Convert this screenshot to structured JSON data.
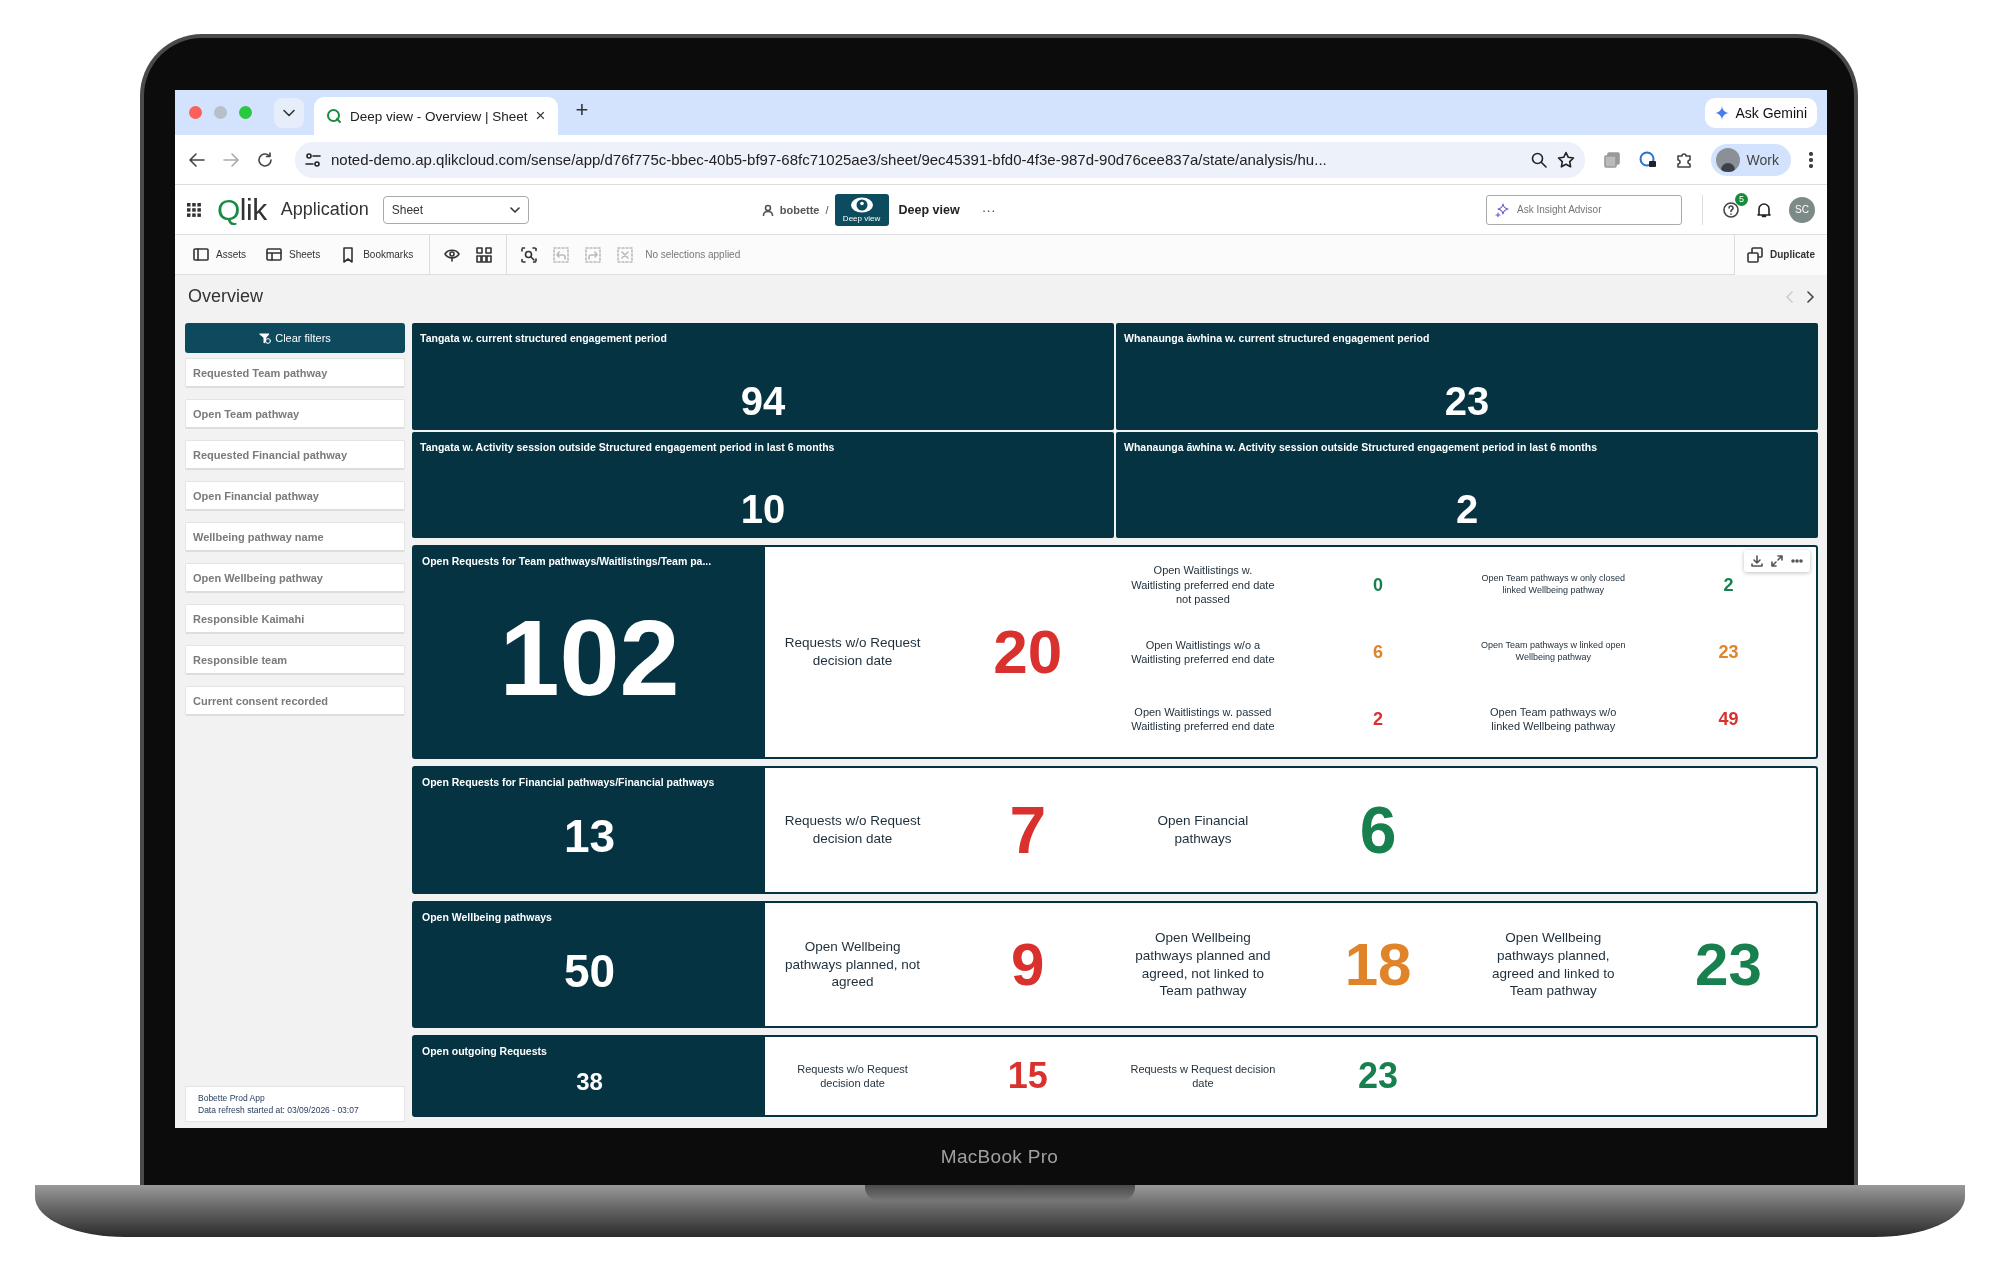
{
  "device_label": "MacBook Pro",
  "browser": {
    "tabs": [
      {
        "title": "Deep view - Overview | Sheet",
        "selected": true
      }
    ],
    "new_tab": "+",
    "close": "×",
    "url": "noted-demo.ap.qlikcloud.com/sense/app/d76f775c-bbec-40b5-bf97-68fc71025ae3/sheet/9ec45391-bfd0-4f3e-987d-90d76cee837a/state/analysis/hu...",
    "forward_disabled": true,
    "ask_gemini": "Ask Gemini",
    "profile": "Work"
  },
  "app_header": {
    "logo": "Qlik",
    "app_name": "Application",
    "sheet_select": "Sheet",
    "user": "bobette",
    "separator": "/",
    "app_thumb_label": "Deep view",
    "app_title": "Deep view",
    "more": "···",
    "search": {
      "placeholder": "Ask Insight Advisor"
    },
    "help_badge": "5",
    "avatar": "SC"
  },
  "toolbar": {
    "items": [
      {
        "kind": "assets",
        "label": "Assets"
      },
      {
        "kind": "sheets",
        "label": "Sheets"
      },
      {
        "kind": "bookmarks",
        "label": "Bookmarks"
      }
    ],
    "selection_tools_disabled": true,
    "selections": "No selections applied",
    "duplicate": "Duplicate"
  },
  "sheet": {
    "title": "Overview",
    "previous_disabled": true
  },
  "sidebar": {
    "clear_filters": "Clear filters",
    "filters": [
      "Requested Team pathway",
      "Open Team pathway",
      "Requested Financial pathway",
      "Open Financial pathway",
      "Wellbeing pathway name",
      "Open Wellbeing pathway",
      "Responsible Kaimahi",
      "Responsible team",
      "Current consent recorded"
    ],
    "footer": [
      "Bobette Prod App",
      "Data refresh started at: 03/09/2026 - 03:07"
    ]
  },
  "kpis": [
    {
      "title": "Tangata w. current structured engagement period",
      "value": "94"
    },
    {
      "title": "Whanaunga āwhina w. current structured engagement period",
      "value": "23"
    },
    {
      "title": "Tangata w. Activity session outside Structured engagement period in last 6 months",
      "value": "10"
    },
    {
      "title": "Whanaunga āwhina w. Activity session outside Structured engagement period in last 6 months",
      "value": "2"
    }
  ],
  "rows": [
    {
      "title": "Open Requests for Team pathways/Waitlistings/Team pa...",
      "value": "102",
      "hover_menu": true,
      "groups": [
        [
          {
            "label": "Requests w/o Request decision date",
            "value": "20",
            "color": "#d9312e"
          }
        ],
        [
          {
            "label": "Open Waitlistings w. Waitlisting preferred end date not passed",
            "value": "0",
            "color": "#18804f"
          },
          {
            "label": "Open Waitlistings w/o a Waitlisting preferred end date",
            "value": "6",
            "color": "#e0842a"
          },
          {
            "label": "Open Waitlistings w. passed Waitlisting preferred end date",
            "value": "2",
            "color": "#d9312e"
          }
        ],
        [
          {
            "label": "Open Team pathways w only closed linked Wellbeing pathway",
            "value": "2",
            "color": "#18804f"
          },
          {
            "label": "Open Team pathways w linked open Wellbeing pathway",
            "value": "23",
            "color": "#e0842a"
          },
          {
            "label": "Open Team pathways w/o linked Wellbeing pathway",
            "value": "49",
            "color": "#d9312e"
          }
        ]
      ]
    },
    {
      "title": "Open Requests for Financial pathways/Financial pathways",
      "value": "13",
      "hover_menu": false,
      "groups": [
        [
          {
            "label": "Requests w/o Request decision date",
            "value": "7",
            "color": "#d9312e"
          }
        ],
        [
          {
            "label": "Open Financial pathways",
            "value": "6",
            "color": "#18804f"
          }
        ]
      ]
    },
    {
      "title": "Open Wellbeing pathways",
      "value": "50",
      "hover_menu": false,
      "groups": [
        [
          {
            "label": "Open Wellbeing pathways planned, not agreed",
            "value": "9",
            "color": "#d9312e"
          }
        ],
        [
          {
            "label": "Open Wellbeing pathways planned and agreed, not linked to Team pathway",
            "value": "18",
            "color": "#e0842a"
          }
        ],
        [
          {
            "label": "Open Wellbeing pathways planned, agreed and linked to Team pathway",
            "value": "23",
            "color": "#18804f"
          }
        ]
      ]
    },
    {
      "title": "Open outgoing Requests",
      "value": "38",
      "hover_menu": false,
      "groups": [
        [
          {
            "label": "Requests w/o Request decision date",
            "value": "15",
            "color": "#d9312e"
          }
        ],
        [
          {
            "label": "Requests w Request decision date",
            "value": "23",
            "color": "#18804f"
          }
        ]
      ]
    }
  ]
}
